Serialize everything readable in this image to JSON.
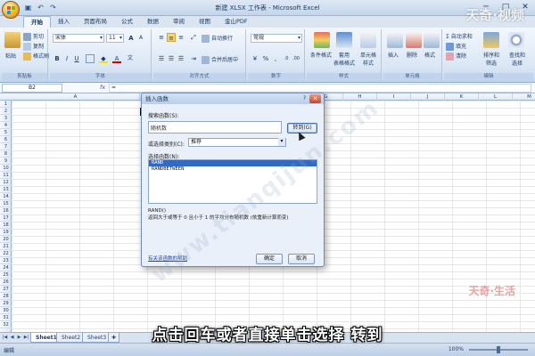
{
  "window": {
    "title": "新建 XLSX 工作表 - Microsoft Excel",
    "controls": [
      "─",
      "□",
      "✕"
    ]
  },
  "ribbon": {
    "tabs": [
      "开始",
      "插入",
      "页面布局",
      "公式",
      "数据",
      "审阅",
      "视图",
      "金山PDF"
    ],
    "clipboard": {
      "paste": "粘贴",
      "cut": "剪切",
      "copy": "复制",
      "format_painter": "格式刷",
      "group": "剪贴板"
    },
    "font": {
      "name": "宋体",
      "size": "11",
      "bold": "B",
      "italic": "I",
      "underline": "U",
      "grow": "A",
      "shrink": "A",
      "color_a": "A",
      "wen": "文",
      "group": "字体"
    },
    "alignment": {
      "wrap": "自动换行",
      "merge": "合并后居中",
      "group": "对齐方式"
    },
    "number": {
      "format": "常规",
      "percent": "%",
      "comma": ",",
      "group": "数字"
    },
    "styles": {
      "conditional": "条件格式",
      "table": "套用\n表格格式",
      "cell": "单元格\n样式",
      "group": "样式"
    },
    "cells": {
      "insert": "插入",
      "delete": "删除",
      "format": "格式",
      "group": "单元格"
    },
    "editing": {
      "autosum": "自动求和",
      "fill": "填充",
      "clear": "清除",
      "sort": "排序和\n筛选",
      "find": "查找和\n选择",
      "group": "编辑"
    }
  },
  "formula_bar": {
    "name_box": "B2",
    "fx": "fx",
    "content": "="
  },
  "grid": {
    "columns": [
      "A",
      "B",
      "C",
      "D",
      "E",
      "F",
      "G",
      "H",
      "I",
      "J",
      "K",
      "L",
      "M",
      "N"
    ],
    "rows": [
      "1",
      "2",
      "3",
      "4",
      "5",
      "6",
      "7",
      "8",
      "9",
      "10",
      "11",
      "12",
      "13",
      "14",
      "15",
      "16",
      "17",
      "18",
      "19",
      "20",
      "21",
      "22",
      "23",
      "24",
      "25",
      "26",
      "27",
      "28",
      "29",
      "30",
      "31",
      "32"
    ]
  },
  "dialog": {
    "title": "插入函数",
    "help": "?",
    "close": "✕",
    "search_label": "搜索函数(S):",
    "search_value": "随机数",
    "go_button": "转到(G)",
    "category_label": "或选择类别(C):",
    "category_value": "推荐",
    "select_label": "选择函数(N):",
    "functions": [
      "RAND",
      "RANDBETWEEN"
    ],
    "signature": "RAND()",
    "description": "返回大于或等于 0 且小于 1 的平均分布随机数 (依重新计算而变)",
    "help_link": "有关该函数的帮助",
    "ok_button": "确定",
    "cancel_button": "取消"
  },
  "sheet_tabs": [
    "Sheet1",
    "Sheet2",
    "Sheet3"
  ],
  "status": {
    "mode": "编辑",
    "zoom": "100%"
  },
  "overlay": {
    "subtitle": "点击回车或者直接单击选择 转到",
    "watermark_top": "天奇·视频",
    "watermark_bottom": "天奇·生活",
    "watermark_diag": "www.tianqijun.com"
  }
}
